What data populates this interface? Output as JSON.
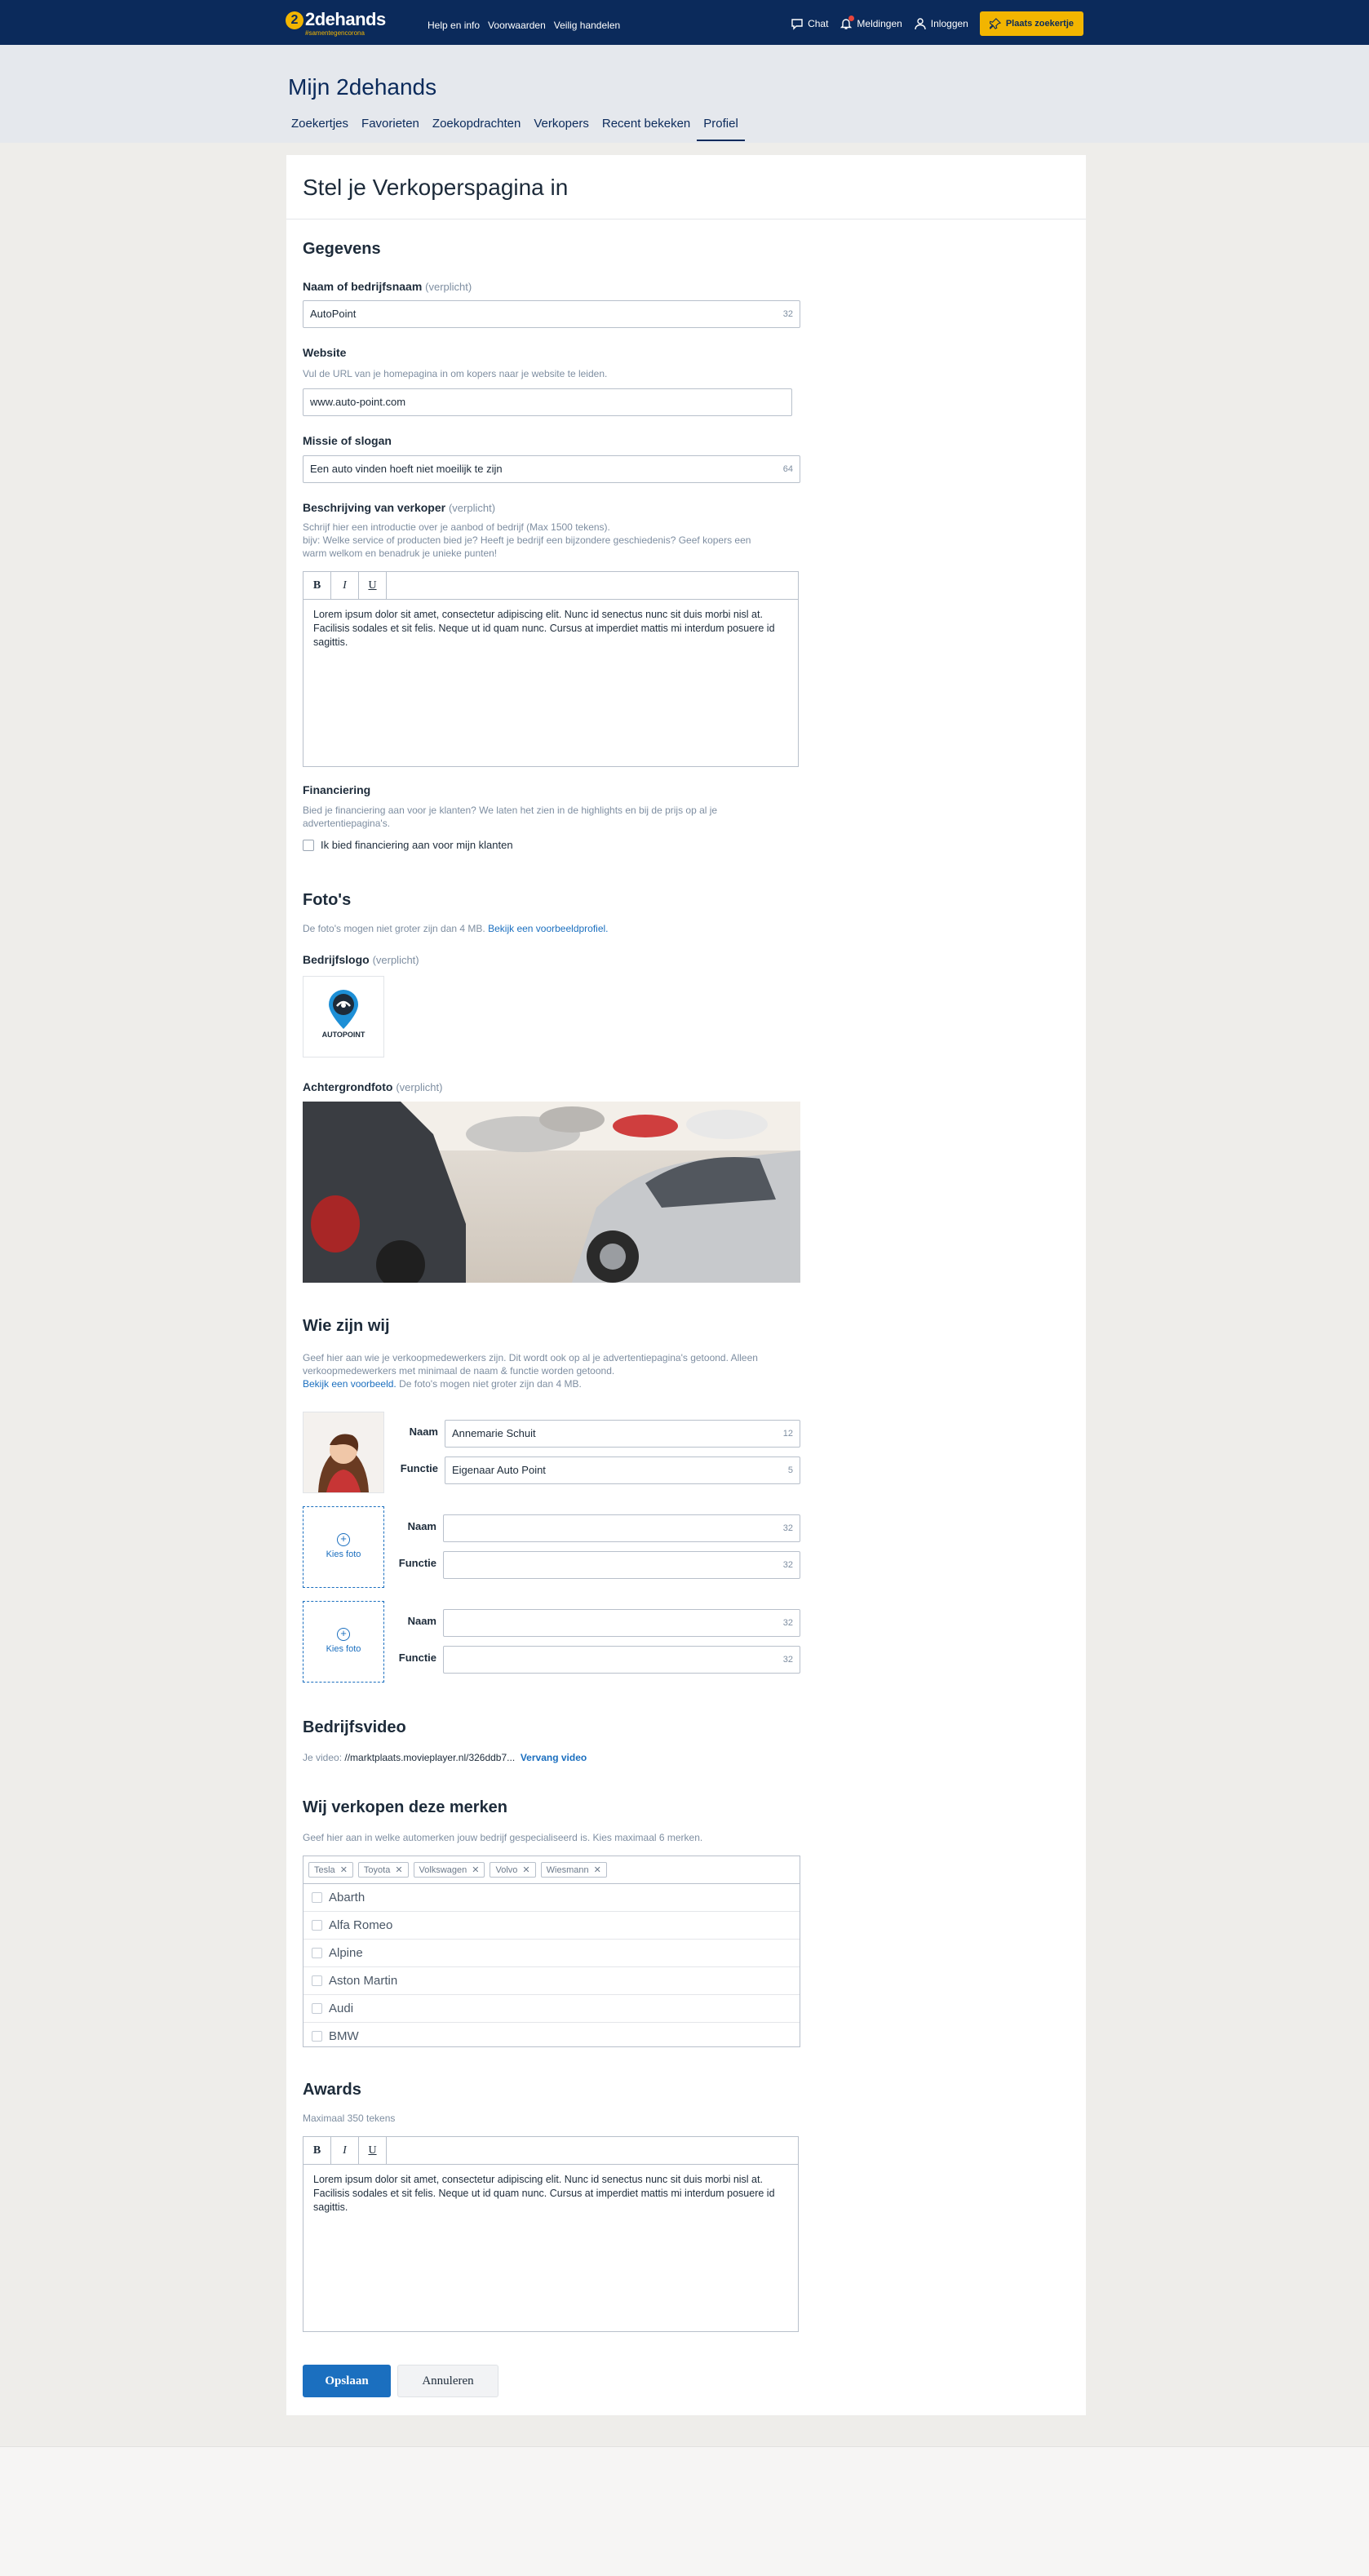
{
  "header": {
    "logo_name": "2dehands",
    "logo_tagline": "#samentegencorona",
    "nav": [
      "Help en info",
      "Voorwaarden",
      "Veilig handelen"
    ],
    "chat": "Chat",
    "notifications": "Meldingen",
    "login": "Inloggen",
    "place_ad": "Plaats zoekertje"
  },
  "subheader": {
    "title": "Mijn 2dehands",
    "tabs": [
      "Zoekertjes",
      "Favorieten",
      "Zoekopdrachten",
      "Verkopers",
      "Recent bekeken",
      "Profiel"
    ]
  },
  "form": {
    "title": "Stel je Verkoperspagina in",
    "gegevens": {
      "title": "Gegevens",
      "name_label": "Naam of bedrijfsnaam",
      "required": "(verplicht)",
      "name_value": "AutoPoint",
      "name_counter": "32",
      "website_label": "Website",
      "website_help": "Vul de URL van je homepagina in om kopers naar je website te leiden.",
      "website_value": "www.auto-point.com",
      "slogan_label": "Missie of slogan",
      "slogan_value": "Een auto vinden hoeft niet moeilijk te zijn",
      "slogan_counter": "64",
      "desc_label": "Beschrijving van verkoper",
      "desc_help_1": "Schrijf hier een introductie over je aanbod of bedrijf (Max 1500 tekens).",
      "desc_help_2": "bijv: Welke service of producten bied je? Heeft je bedrijf een bijzondere geschiedenis? Geef kopers een warm welkom en benadruk je unieke punten!",
      "editor_bold": "B",
      "editor_italic": "I",
      "editor_underline": "U",
      "desc_text": "Lorem ipsum dolor sit amet, consectetur adipiscing elit. Nunc id senectus nunc sit duis morbi nisl at. Facilisis sodales et sit felis. Neque ut id quam nunc. Cursus at imperdiet mattis mi interdum posuere id sagittis.",
      "financing_label": "Financiering",
      "financing_help": "Bied je financiering aan voor je klanten? We laten het zien in de highlights en bij de prijs op al je advertentiepagina's.",
      "financing_checkbox": "Ik bied financiering aan voor mijn klanten"
    },
    "photos": {
      "title": "Foto's",
      "help": "De foto's mogen niet groter zijn dan 4 MB.",
      "help_link": "Bekijk een voorbeeldprofiel.",
      "logo_label": "Bedrijfslogo",
      "logo_text": "AUTOPOINT",
      "background_label": "Achtergrondfoto"
    },
    "team": {
      "title": "Wie zijn wij",
      "help_1": "Geef hier aan wie je verkoopmedewerkers zijn. Dit wordt ook op al je advertentiepagina's getoond. Alleen verkoopmedewerkers met minimaal de naam & functie worden getoond.",
      "help_link": "Bekijk een voorbeeld.",
      "help_2": " De foto's mogen niet groter zijn dan 4 MB.",
      "name_label": "Naam",
      "function_label": "Functie",
      "pick_photo": "Kies foto",
      "members": [
        {
          "name": "Annemarie Schuit",
          "name_counter": "12",
          "function": "Eigenaar Auto Point",
          "function_counter": "5"
        },
        {
          "name": "",
          "name_counter": "32",
          "function": "",
          "function_counter": "32"
        },
        {
          "name": "",
          "name_counter": "32",
          "function": "",
          "function_counter": "32"
        }
      ]
    },
    "video": {
      "title": "Bedrijfsvideo",
      "prefix": "Je video:",
      "url": "//marktplaats.movieplayer.nl/326ddb7...",
      "replace": "Vervang video"
    },
    "brands": {
      "title": "Wij verkopen deze merken",
      "help": "Geef hier aan in welke automerken jouw bedrijf gespecialiseerd is. Kies maximaal 6 merken.",
      "selected": [
        "Tesla",
        "Toyota",
        "Volkswagen",
        "Volvo",
        "Wiesmann"
      ],
      "list": [
        "Abarth",
        "Alfa Romeo",
        "Alpine",
        "Aston Martin",
        "Audi",
        "BMW"
      ]
    },
    "awards": {
      "title": "Awards",
      "help": "Maximaal 350 tekens",
      "text": "Lorem ipsum dolor sit amet, consectetur adipiscing elit. Nunc id senectus nunc sit duis morbi nisl at. Facilisis sodales et sit felis. Neque ut id quam nunc. Cursus at imperdiet mattis mi interdum posuere id sagittis."
    },
    "save": "Opslaan",
    "cancel": "Annuleren"
  },
  "colors": {
    "header_bg": "#0b2a5b",
    "accent_yellow": "#f2b500",
    "link_blue": "#1b6fbf"
  }
}
